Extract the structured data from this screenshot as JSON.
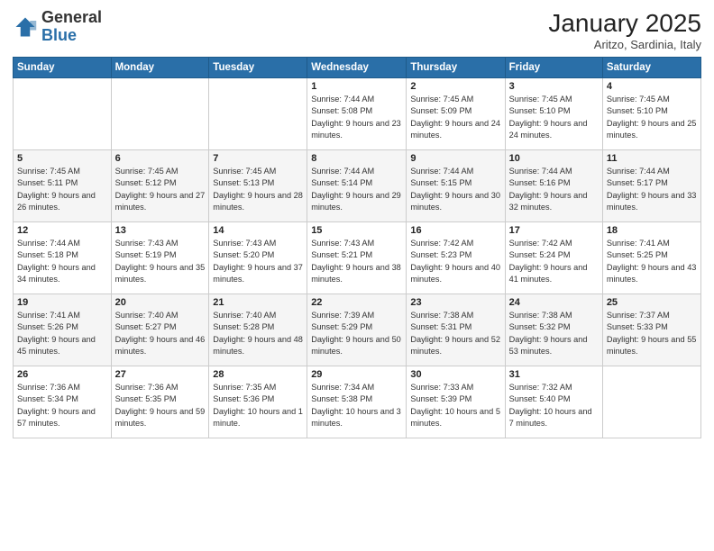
{
  "logo": {
    "general": "General",
    "blue": "Blue"
  },
  "header": {
    "month": "January 2025",
    "location": "Aritzo, Sardinia, Italy"
  },
  "weekdays": [
    "Sunday",
    "Monday",
    "Tuesday",
    "Wednesday",
    "Thursday",
    "Friday",
    "Saturday"
  ],
  "weeks": [
    [
      {
        "day": "",
        "info": ""
      },
      {
        "day": "",
        "info": ""
      },
      {
        "day": "",
        "info": ""
      },
      {
        "day": "1",
        "info": "Sunrise: 7:44 AM\nSunset: 5:08 PM\nDaylight: 9 hours and 23 minutes."
      },
      {
        "day": "2",
        "info": "Sunrise: 7:45 AM\nSunset: 5:09 PM\nDaylight: 9 hours and 24 minutes."
      },
      {
        "day": "3",
        "info": "Sunrise: 7:45 AM\nSunset: 5:10 PM\nDaylight: 9 hours and 24 minutes."
      },
      {
        "day": "4",
        "info": "Sunrise: 7:45 AM\nSunset: 5:10 PM\nDaylight: 9 hours and 25 minutes."
      }
    ],
    [
      {
        "day": "5",
        "info": "Sunrise: 7:45 AM\nSunset: 5:11 PM\nDaylight: 9 hours and 26 minutes."
      },
      {
        "day": "6",
        "info": "Sunrise: 7:45 AM\nSunset: 5:12 PM\nDaylight: 9 hours and 27 minutes."
      },
      {
        "day": "7",
        "info": "Sunrise: 7:45 AM\nSunset: 5:13 PM\nDaylight: 9 hours and 28 minutes."
      },
      {
        "day": "8",
        "info": "Sunrise: 7:44 AM\nSunset: 5:14 PM\nDaylight: 9 hours and 29 minutes."
      },
      {
        "day": "9",
        "info": "Sunrise: 7:44 AM\nSunset: 5:15 PM\nDaylight: 9 hours and 30 minutes."
      },
      {
        "day": "10",
        "info": "Sunrise: 7:44 AM\nSunset: 5:16 PM\nDaylight: 9 hours and 32 minutes."
      },
      {
        "day": "11",
        "info": "Sunrise: 7:44 AM\nSunset: 5:17 PM\nDaylight: 9 hours and 33 minutes."
      }
    ],
    [
      {
        "day": "12",
        "info": "Sunrise: 7:44 AM\nSunset: 5:18 PM\nDaylight: 9 hours and 34 minutes."
      },
      {
        "day": "13",
        "info": "Sunrise: 7:43 AM\nSunset: 5:19 PM\nDaylight: 9 hours and 35 minutes."
      },
      {
        "day": "14",
        "info": "Sunrise: 7:43 AM\nSunset: 5:20 PM\nDaylight: 9 hours and 37 minutes."
      },
      {
        "day": "15",
        "info": "Sunrise: 7:43 AM\nSunset: 5:21 PM\nDaylight: 9 hours and 38 minutes."
      },
      {
        "day": "16",
        "info": "Sunrise: 7:42 AM\nSunset: 5:23 PM\nDaylight: 9 hours and 40 minutes."
      },
      {
        "day": "17",
        "info": "Sunrise: 7:42 AM\nSunset: 5:24 PM\nDaylight: 9 hours and 41 minutes."
      },
      {
        "day": "18",
        "info": "Sunrise: 7:41 AM\nSunset: 5:25 PM\nDaylight: 9 hours and 43 minutes."
      }
    ],
    [
      {
        "day": "19",
        "info": "Sunrise: 7:41 AM\nSunset: 5:26 PM\nDaylight: 9 hours and 45 minutes."
      },
      {
        "day": "20",
        "info": "Sunrise: 7:40 AM\nSunset: 5:27 PM\nDaylight: 9 hours and 46 minutes."
      },
      {
        "day": "21",
        "info": "Sunrise: 7:40 AM\nSunset: 5:28 PM\nDaylight: 9 hours and 48 minutes."
      },
      {
        "day": "22",
        "info": "Sunrise: 7:39 AM\nSunset: 5:29 PM\nDaylight: 9 hours and 50 minutes."
      },
      {
        "day": "23",
        "info": "Sunrise: 7:38 AM\nSunset: 5:31 PM\nDaylight: 9 hours and 52 minutes."
      },
      {
        "day": "24",
        "info": "Sunrise: 7:38 AM\nSunset: 5:32 PM\nDaylight: 9 hours and 53 minutes."
      },
      {
        "day": "25",
        "info": "Sunrise: 7:37 AM\nSunset: 5:33 PM\nDaylight: 9 hours and 55 minutes."
      }
    ],
    [
      {
        "day": "26",
        "info": "Sunrise: 7:36 AM\nSunset: 5:34 PM\nDaylight: 9 hours and 57 minutes."
      },
      {
        "day": "27",
        "info": "Sunrise: 7:36 AM\nSunset: 5:35 PM\nDaylight: 9 hours and 59 minutes."
      },
      {
        "day": "28",
        "info": "Sunrise: 7:35 AM\nSunset: 5:36 PM\nDaylight: 10 hours and 1 minute."
      },
      {
        "day": "29",
        "info": "Sunrise: 7:34 AM\nSunset: 5:38 PM\nDaylight: 10 hours and 3 minutes."
      },
      {
        "day": "30",
        "info": "Sunrise: 7:33 AM\nSunset: 5:39 PM\nDaylight: 10 hours and 5 minutes."
      },
      {
        "day": "31",
        "info": "Sunrise: 7:32 AM\nSunset: 5:40 PM\nDaylight: 10 hours and 7 minutes."
      },
      {
        "day": "",
        "info": ""
      }
    ]
  ]
}
